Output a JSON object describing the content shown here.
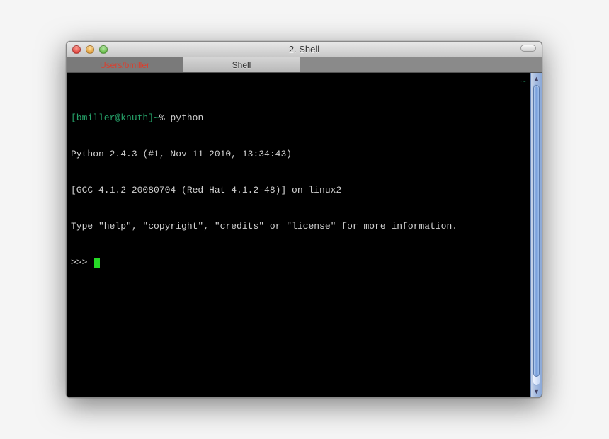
{
  "window": {
    "title": "2. Shell"
  },
  "tabs": [
    {
      "label": "Users/bmiller",
      "active": false
    },
    {
      "label": "Shell",
      "active": true
    }
  ],
  "terminal": {
    "prompt_host": "[bmiller@knuth]~",
    "prompt_symbol": "%",
    "command": "python",
    "tilde_indicator": "~",
    "output_lines": [
      "Python 2.4.3 (#1, Nov 11 2010, 13:34:43)",
      "[GCC 4.1.2 20080704 (Red Hat 4.1.2-48)] on linux2",
      "Type \"help\", \"copyright\", \"credits\" or \"license\" for more information."
    ],
    "repl_prompt": ">>>"
  }
}
